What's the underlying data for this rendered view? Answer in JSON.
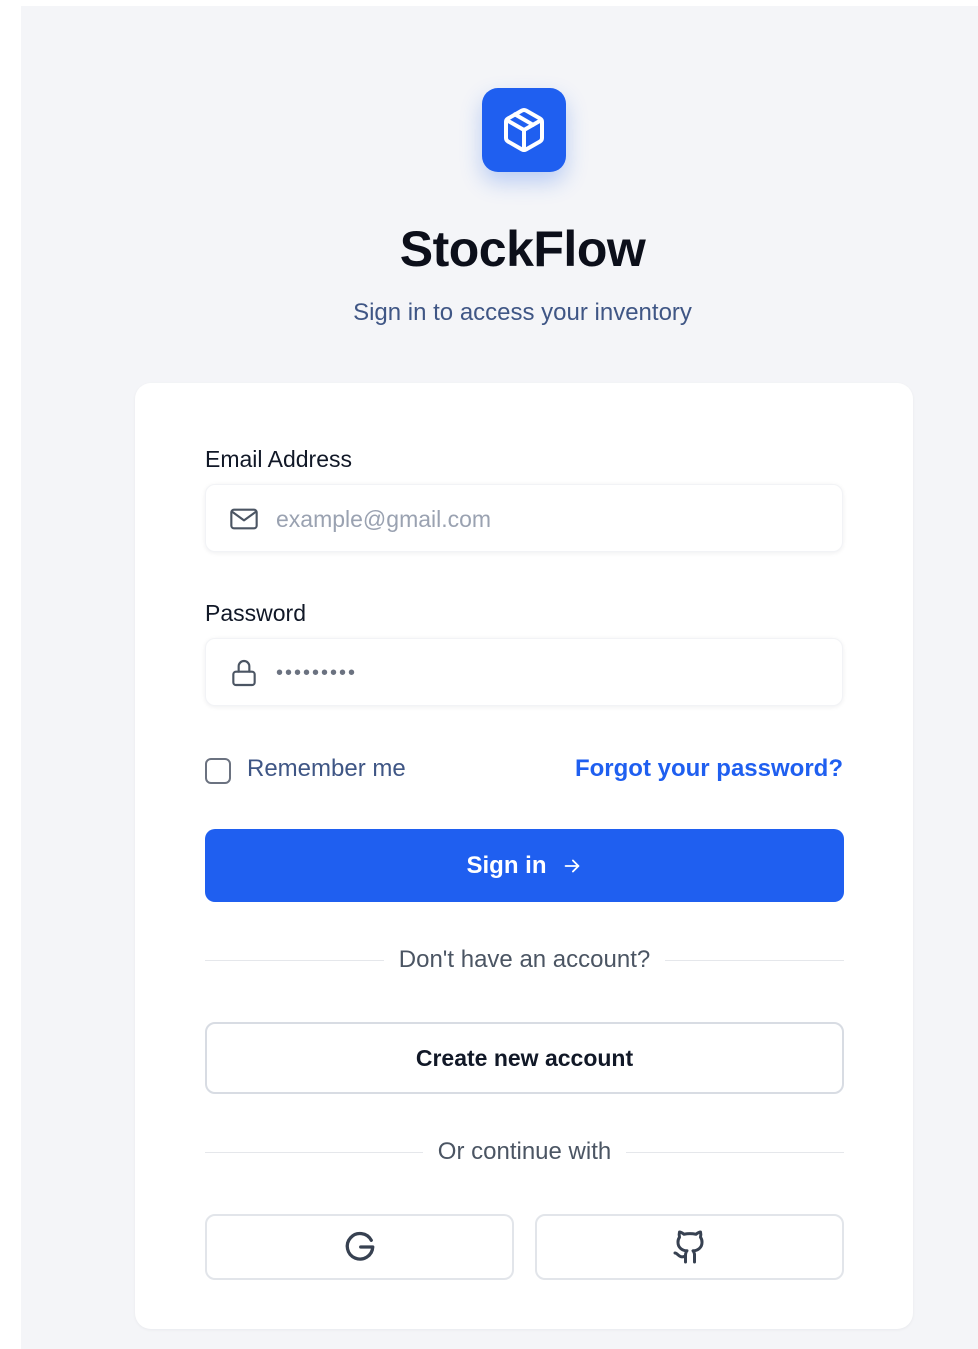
{
  "app": {
    "brand": "StockFlow",
    "subtitle": "Sign in to access your inventory",
    "logo_icon": "cube-icon",
    "accent_color": "#1f5ff0"
  },
  "form": {
    "email": {
      "label": "Email Address",
      "placeholder": "example@gmail.com",
      "value": "",
      "icon": "mail-icon"
    },
    "password": {
      "label": "Password",
      "masked_value": "•••••••••",
      "icon": "lock-icon"
    },
    "remember_label": "Remember me",
    "remember_checked": false,
    "forgot_label": "Forgot your password?",
    "signin_label": "Sign in",
    "signin_icon": "arrow-right-icon",
    "no_account_text": "Don't have an account?",
    "create_label": "Create new account",
    "continue_text": "Or continue with",
    "social": [
      {
        "name": "Google",
        "icon": "google-icon"
      },
      {
        "name": "GitHub",
        "icon": "github-icon"
      }
    ]
  }
}
